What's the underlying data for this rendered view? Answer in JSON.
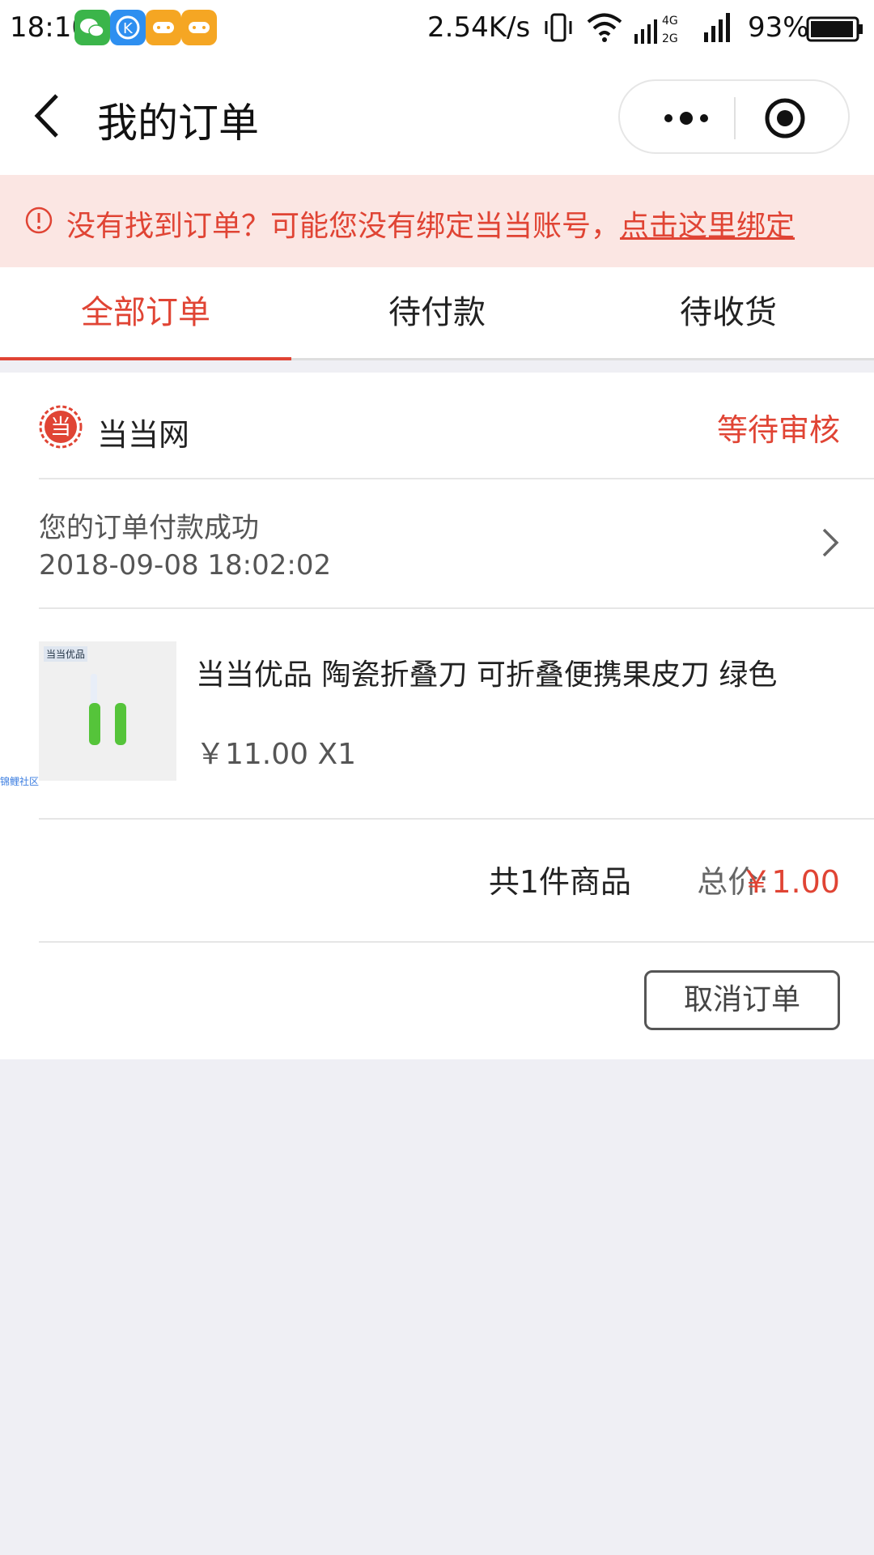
{
  "status_bar": {
    "time": "18:10",
    "network_speed": "2.54K/s",
    "network_type_top": "4G",
    "network_type_bottom": "2G",
    "battery": "93%",
    "app_icons": [
      "wechat-icon",
      "k-app-icon",
      "game-icon",
      "game-icon"
    ]
  },
  "nav": {
    "title": "我的订单"
  },
  "notice": {
    "text": "没有找到订单？可能您没有绑定当当账号，",
    "link": "点击这里绑定"
  },
  "tabs": [
    {
      "label": "全部订单",
      "active": true
    },
    {
      "label": "待付款",
      "active": false
    },
    {
      "label": "待收货",
      "active": false
    }
  ],
  "order": {
    "shop_logo_char": "当",
    "shop_name": "当当网",
    "status": "等待审核",
    "message": "您的订单付款成功",
    "time": "2018-09-08 18:02:02",
    "product": {
      "image_tag": "当当优品",
      "title": "当当优品 陶瓷折叠刀 可折叠便携果皮刀 绿色",
      "price": "￥11.00 X1"
    },
    "watermark": "锦鲤社区",
    "summary_count": "共1件商品",
    "summary_label": "总价:",
    "summary_total": "￥1.00",
    "cancel_label": "取消订单"
  },
  "colors": {
    "accent": "#e04434",
    "notice_bg": "#fbe6e3",
    "page_bg": "#efeff4"
  }
}
